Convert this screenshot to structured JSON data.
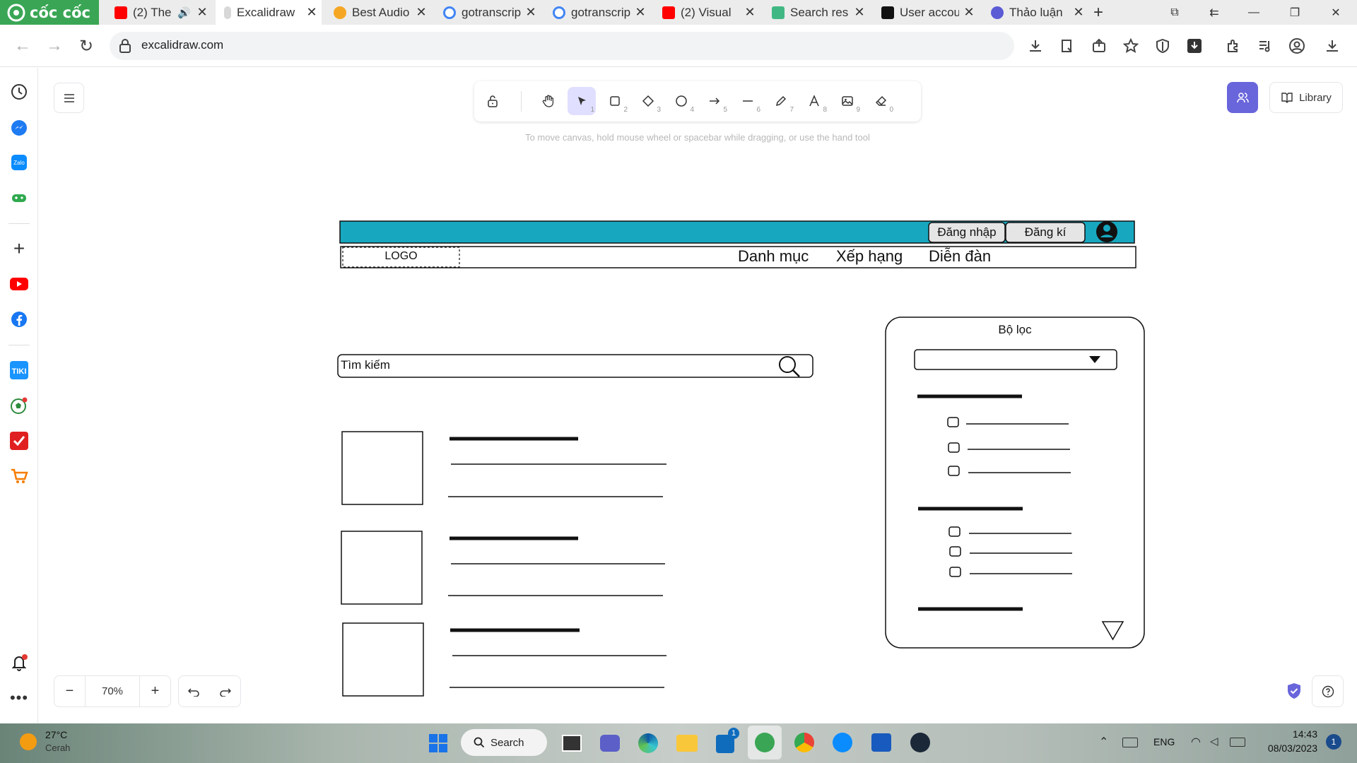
{
  "browser": {
    "brand": "cốc cốc",
    "tabs": [
      {
        "title": "(2) The",
        "icon": "youtube-icon"
      },
      {
        "title": "Excalidraw",
        "icon": "excalidraw-icon",
        "active": true
      },
      {
        "title": "Best Audio",
        "icon": "google-icon"
      },
      {
        "title": "gotranscript",
        "icon": "google-icon"
      },
      {
        "title": "gotranscript",
        "icon": "google-icon"
      },
      {
        "title": "(2) Visual",
        "icon": "youtube-icon"
      },
      {
        "title": "Search res",
        "icon": "v-icon"
      },
      {
        "title": "User accou",
        "icon": "st-icon"
      },
      {
        "title": "Thảo luận",
        "icon": "l-icon"
      }
    ],
    "url": "excalidraw.com"
  },
  "excalidraw": {
    "hint": "To move canvas, hold mouse wheel or spacebar while dragging, or use the hand tool",
    "library_label": "Library",
    "zoom_label": "70%",
    "tool_numbers": [
      "1",
      "2",
      "3",
      "4",
      "5",
      "6",
      "7",
      "8",
      "9",
      "0"
    ]
  },
  "mockup": {
    "login_label": "Đăng nhập",
    "register_label": "Đăng kí",
    "logo_label": "LOGO",
    "nav_items": [
      "Danh mục",
      "Xếp hạng",
      "Diễn đàn"
    ],
    "search_placeholder": "Tìm kiếm",
    "filter_title": "Bộ lọc"
  },
  "taskbar": {
    "weather_temp": "27°C",
    "weather_desc": "Cerah",
    "search_label": "Search",
    "lang": "ENG",
    "time": "14:43",
    "date": "08/03/2023",
    "notif_count": "1",
    "store_badge": "1"
  },
  "colors": {
    "header_teal": "#17a8c0",
    "toolbar_selected": "#e0dfff",
    "collab_purple": "#6965db",
    "brand_green": "#3aa655"
  }
}
